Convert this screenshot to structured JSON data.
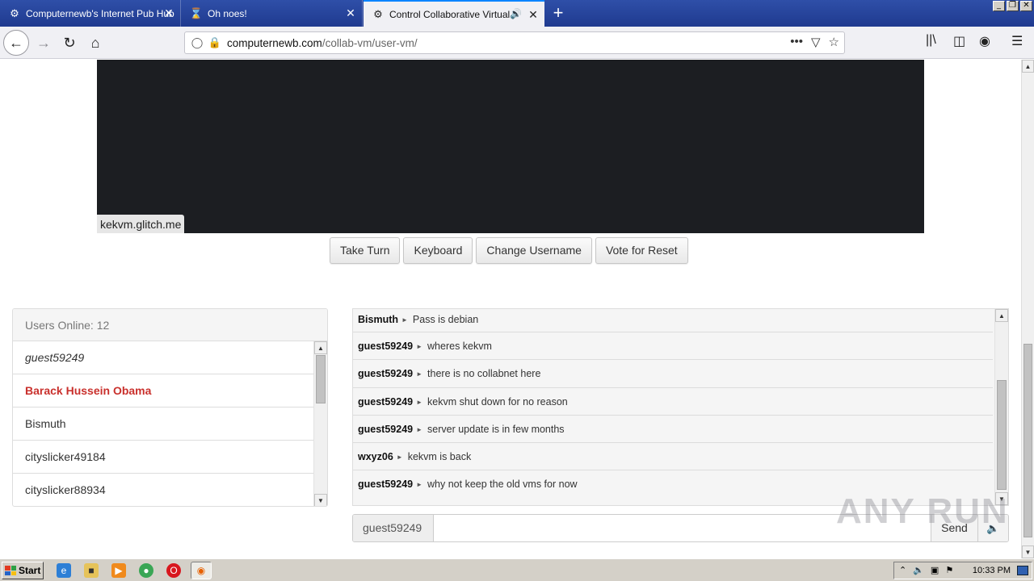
{
  "browser": {
    "tabs": [
      {
        "title": "Computernewb's Internet Pub Hub",
        "icon": "computernewb-icon",
        "active": false
      },
      {
        "title": "Oh noes!",
        "icon": "hourglass-icon",
        "active": false
      },
      {
        "title": "Control Collaborative Virtual M",
        "icon": "computernewb-icon",
        "active": true
      }
    ],
    "url_host": "computernewb.com",
    "url_path": "/collab-vm/user-vm/"
  },
  "vm": {
    "label": "kekvm.glitch.me",
    "buttons": {
      "take_turn": "Take Turn",
      "keyboard": "Keyboard",
      "change_username": "Change Username",
      "vote_reset": "Vote for Reset"
    }
  },
  "users": {
    "header": "Users Online: 12",
    "list": [
      {
        "name": "guest59249",
        "kind": "guest"
      },
      {
        "name": "Barack Hussein Obama",
        "kind": "admin"
      },
      {
        "name": "Bismuth",
        "kind": "normal"
      },
      {
        "name": "cityslicker49184",
        "kind": "normal"
      },
      {
        "name": "cityslicker88934",
        "kind": "normal"
      }
    ]
  },
  "chat": {
    "messages": [
      {
        "user": "Bismuth",
        "text": "Pass is debian"
      },
      {
        "user": "guest59249",
        "text": "wheres kekvm"
      },
      {
        "user": "guest59249",
        "text": "there is no collabnet here"
      },
      {
        "user": "guest59249",
        "text": "kekvm shut down for no reason"
      },
      {
        "user": "guest59249",
        "text": "server update is in few months"
      },
      {
        "user": "wxyz06",
        "text": "kekvm is back"
      },
      {
        "user": "guest59249",
        "text": "why not keep the old vms for now"
      }
    ],
    "username": "guest59249",
    "input_value": "",
    "send_label": "Send"
  },
  "watermark": "ANY RUN",
  "taskbar": {
    "start_label": "Start",
    "clock": "10:33 PM"
  },
  "colors": {
    "tab_strip": "#1f3a8f",
    "vm_screen": "#1c1e22",
    "admin_name": "#c9302c",
    "taskbar": "#d4d0c8"
  }
}
